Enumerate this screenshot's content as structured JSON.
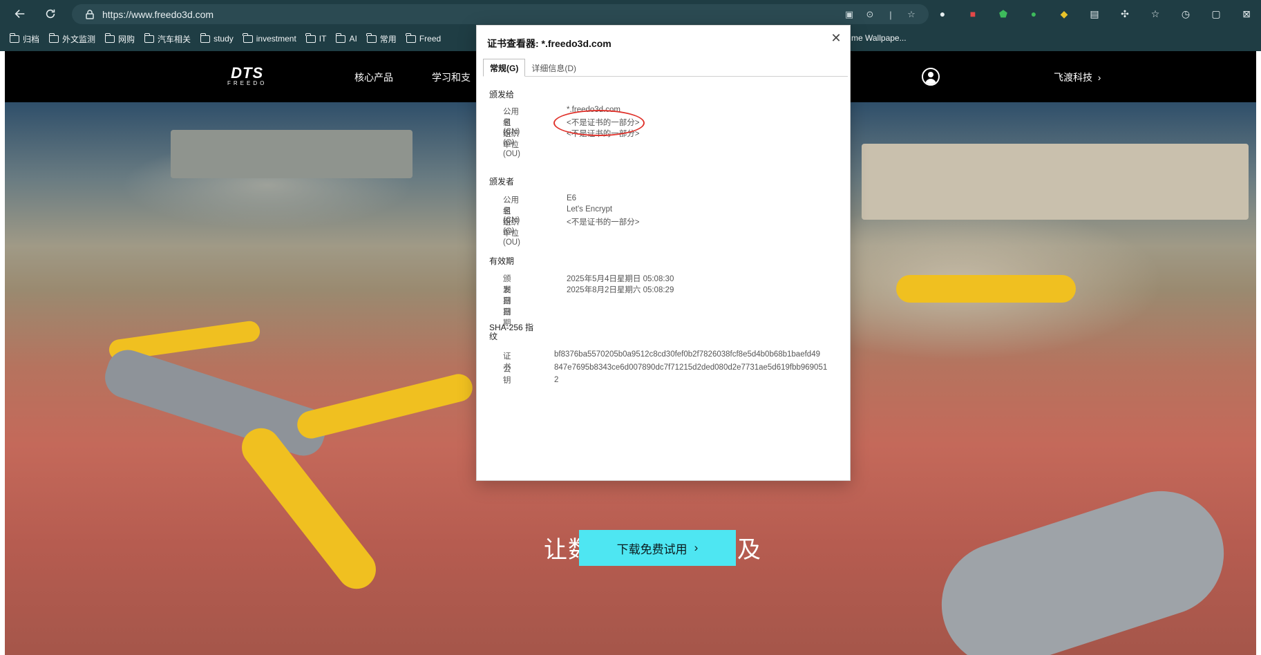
{
  "browser": {
    "url": "https://www.freedo3d.com",
    "bookmarks": [
      "归档",
      "外文监测",
      "网购",
      "汽车相关",
      "study",
      "investment",
      "IT",
      "AI",
      "常用",
      "Freed"
    ],
    "bookmark_right": "me Wallpape..."
  },
  "site": {
    "logo_big": "DTS",
    "logo_small": "FREEDO",
    "nav": [
      "核心产品",
      "学习和支"
    ],
    "company": "飞渡科技",
    "hero_title": "让数字孪生触手可及",
    "cta_label": "下载免费试用"
  },
  "dialog": {
    "title": "证书查看器: *.freedo3d.com",
    "tabs": [
      "常规(G)",
      "详细信息(D)"
    ],
    "issued_to": {
      "heading": "颁发给",
      "rows": [
        {
          "key": "公用名(CN)",
          "value": "*.freedo3d.com"
        },
        {
          "key": "组织(O)",
          "value": "<不是证书的一部分>"
        },
        {
          "key": "组织单位(OU)",
          "value": "<不是证书的一部分>"
        }
      ]
    },
    "issued_by": {
      "heading": "颁发者",
      "rows": [
        {
          "key": "公用名(CN)",
          "value": "E6"
        },
        {
          "key": "组织(O)",
          "value": "Let's Encrypt"
        },
        {
          "key": "组织单位(OU)",
          "value": "<不是证书的一部分>"
        }
      ]
    },
    "validity": {
      "heading": "有效期",
      "rows": [
        {
          "key": "颁发日期",
          "value": "2025年5月4日星期日 05:08:30"
        },
        {
          "key": "到期日期",
          "value": "2025年8月2日星期六 05:08:29"
        }
      ]
    },
    "fingerprint": {
      "heading_1": "SHA-256 指",
      "heading_2": "纹",
      "rows": [
        {
          "key": "证书",
          "value": "bf8376ba5570205b0a9512c8cd30fef0b2f7826038fcf8e5d4b0b68b1baefd49"
        },
        {
          "key": "公钥",
          "value": "847e7695b8343ce6d007890dc7f71215d2ded080d2e7731ae5d619fbb969051"
        }
      ],
      "wrap": "2"
    }
  },
  "colors": {
    "chrome": "#1f3d44",
    "cta": "#4ee6f2",
    "highlight": "#e0332c"
  }
}
